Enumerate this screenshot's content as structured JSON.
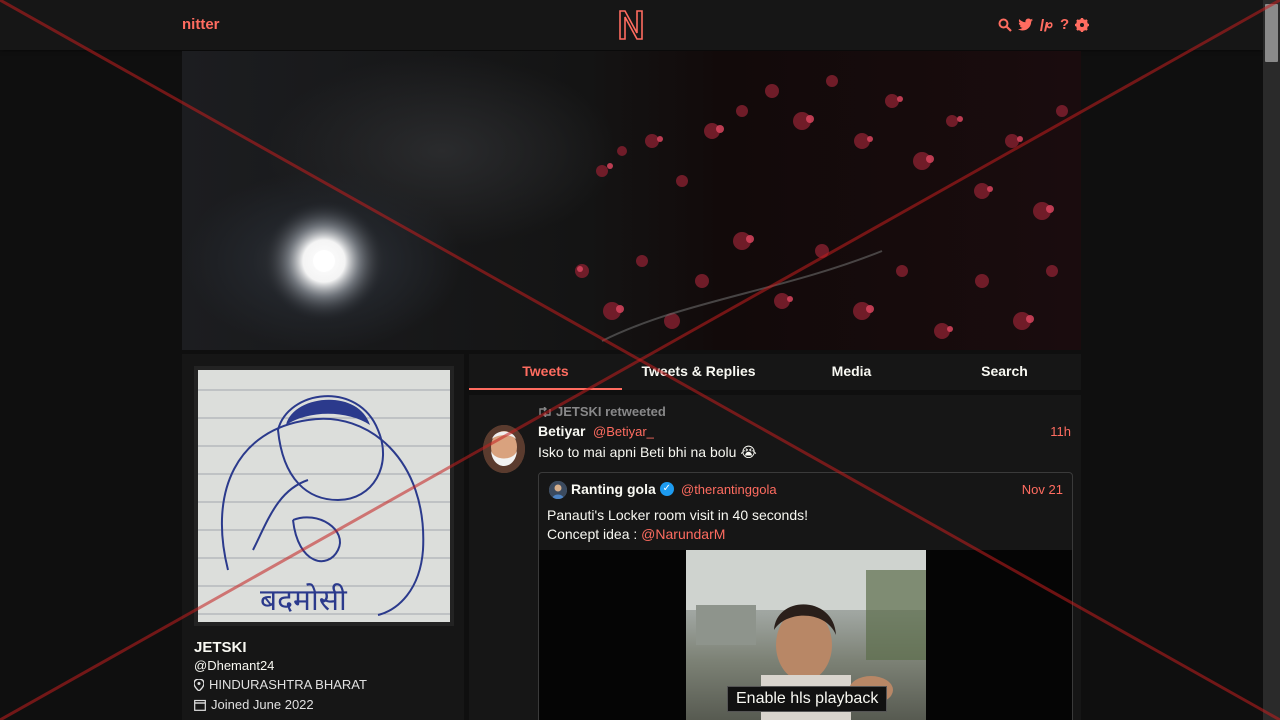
{
  "nav": {
    "brand": "nitter",
    "icons": [
      "search-icon",
      "twitter-icon",
      "lp-icon",
      "help-icon",
      "gear-icon"
    ]
  },
  "profile": {
    "name": "JETSKI",
    "handle": "@Dhemant24",
    "location": "HINDURASHTRA BHARAT",
    "joined": "Joined June 2022",
    "avatar_caption": "बदमोसी"
  },
  "tabs": [
    {
      "label": "Tweets",
      "active": true
    },
    {
      "label": "Tweets & Replies",
      "active": false
    },
    {
      "label": "Media",
      "active": false
    },
    {
      "label": "Search",
      "active": false
    }
  ],
  "tweet": {
    "retweet_label": "JETSKI retweeted",
    "author_name": "Betiyar",
    "author_username": "@Betiyar_",
    "date": "11h",
    "text": "Isko to mai apni Beti bhi na bolu 😭",
    "quote": {
      "author_name": "Ranting gola",
      "author_username": "@therantinggola",
      "date": "Nov 21",
      "text_line1": "Panauti's Locker room visit in 40 seconds!",
      "text_line2_prefix": "Concept idea : ",
      "mention": "@NarundarM",
      "video_button": "Enable hls playback"
    }
  },
  "colors": {
    "accent": "#ff6c60",
    "background": "#0f0f0f",
    "panel": "#161616",
    "overlay_line": "#c41e1e"
  }
}
